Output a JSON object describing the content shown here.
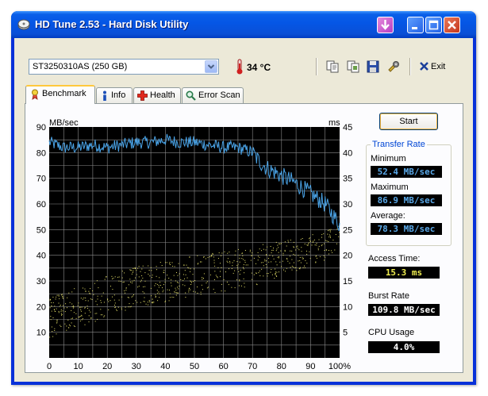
{
  "window": {
    "title": "HD Tune 2.53 - Hard Disk Utility"
  },
  "toolbar": {
    "drive": "ST3250310AS (250 GB)",
    "temperature": "34 °C",
    "exit_label": "Exit"
  },
  "tabs": [
    {
      "label": "Benchmark",
      "icon": "benchmark-icon",
      "active": true
    },
    {
      "label": "Info",
      "icon": "info-icon",
      "active": false
    },
    {
      "label": "Health",
      "icon": "health-icon",
      "active": false
    },
    {
      "label": "Error Scan",
      "icon": "error-scan-icon",
      "active": false
    }
  ],
  "benchmark": {
    "start_label": "Start",
    "transfer_rate_title": "Transfer Rate",
    "minimum_label": "Minimum",
    "minimum": "52.4 MB/sec",
    "maximum_label": "Maximum",
    "maximum": "86.9 MB/sec",
    "average_label": "Average:",
    "average": "78.3 MB/sec",
    "access_time_label": "Access Time:",
    "access_time": "15.3 ms",
    "burst_rate_label": "Burst Rate",
    "burst_rate": "109.8 MB/sec",
    "cpu_usage_label": "CPU Usage",
    "cpu_usage": "4.0%"
  },
  "colors": {
    "transfer_line": "#4aa3e6",
    "access_points": "#e8e36a",
    "grid": "#8c8c8c",
    "plot_bg": "#000000"
  },
  "chart_data": {
    "type": "line",
    "y_left_unit": "MB/sec",
    "y_right_unit": "ms",
    "x_ticks": [
      "0",
      "10",
      "20",
      "30",
      "40",
      "50",
      "60",
      "70",
      "80",
      "90",
      "100%"
    ],
    "y_left_ticks": [
      "90",
      "80",
      "70",
      "60",
      "50",
      "40",
      "30",
      "20",
      "10"
    ],
    "y_right_ticks": [
      "45",
      "40",
      "35",
      "30",
      "25",
      "20",
      "15",
      "10",
      "5"
    ],
    "xlim": [
      0,
      100
    ],
    "ylim_left": [
      0,
      90
    ],
    "ylim_right": [
      0,
      45
    ],
    "grid": true,
    "transfer_rate": {
      "x": [
        0,
        5,
        10,
        15,
        20,
        25,
        30,
        35,
        40,
        45,
        50,
        55,
        60,
        65,
        70,
        72,
        75,
        80,
        85,
        90,
        95,
        100
      ],
      "y": [
        84,
        82,
        82,
        83,
        82,
        83,
        84,
        84,
        85,
        84,
        84,
        83,
        82,
        82,
        80,
        77,
        74,
        71,
        68,
        64,
        60,
        52
      ]
    },
    "access_time_band": {
      "x": [
        0,
        10,
        20,
        30,
        40,
        50,
        60,
        70,
        80,
        90,
        100
      ],
      "low_ms": [
        4,
        6,
        8,
        10,
        11,
        12,
        13,
        14,
        16,
        18,
        20
      ],
      "high_ms": [
        12,
        14,
        16,
        18,
        19,
        20,
        21,
        22,
        23,
        24,
        26
      ]
    }
  }
}
